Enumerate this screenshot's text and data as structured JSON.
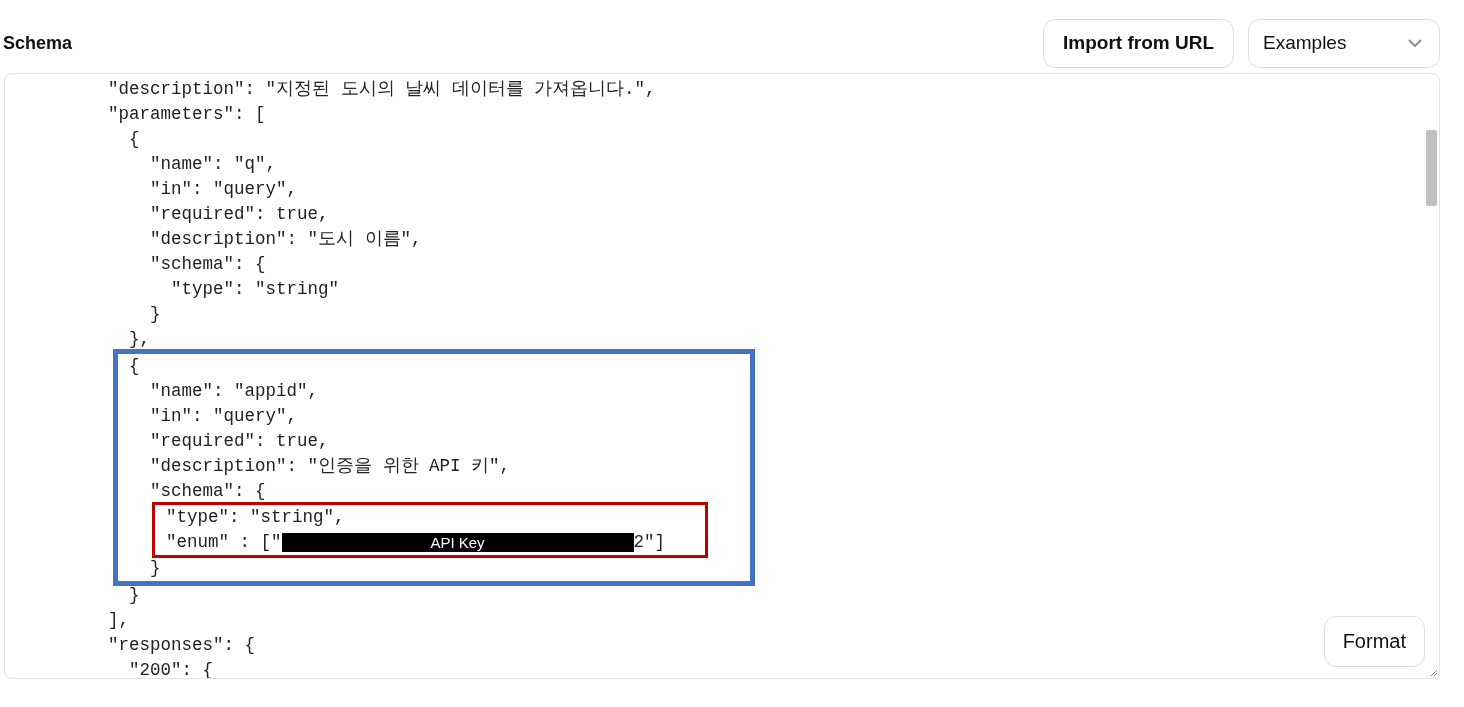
{
  "header": {
    "title": "Schema",
    "import_button": "Import from URL",
    "examples_select": "Examples"
  },
  "editor": {
    "blocks": [
      {
        "kind": "line",
        "text": "\"description\": \"지정된 도시의 날씨 데이터를 가져옵니다.\","
      },
      {
        "kind": "line",
        "text": "\"parameters\": ["
      },
      {
        "kind": "line",
        "text": "  {"
      },
      {
        "kind": "line",
        "text": "    \"name\": \"q\","
      },
      {
        "kind": "line",
        "text": "    \"in\": \"query\","
      },
      {
        "kind": "line",
        "text": "    \"required\": true,"
      },
      {
        "kind": "line",
        "text": "    \"description\": \"도시 이름\","
      },
      {
        "kind": "line",
        "text": "    \"schema\": {"
      },
      {
        "kind": "line",
        "text": "      \"type\": \"string\""
      },
      {
        "kind": "line",
        "text": "    }"
      },
      {
        "kind": "line",
        "text": "  },"
      },
      {
        "kind": "highlight",
        "children": [
          {
            "kind": "line",
            "text": "  {"
          },
          {
            "kind": "line",
            "text": "    \"name\": \"appid\","
          },
          {
            "kind": "line",
            "text": "    \"in\": \"query\","
          },
          {
            "kind": "line",
            "text": "    \"required\": true,"
          },
          {
            "kind": "line",
            "text": "    \"description\": \"인증을 위한 API 키\","
          },
          {
            "kind": "line",
            "text": "    \"schema\": {"
          },
          {
            "kind": "inner_highlight",
            "children": [
              {
                "kind": "line",
                "text": "      \"type\": \"string\","
              },
              {
                "kind": "redacted_line",
                "before": "      \"enum\" : [\"",
                "redaction": "API Key",
                "after": "2\"]"
              }
            ]
          },
          {
            "kind": "line",
            "text": "    }"
          }
        ]
      },
      {
        "kind": "line",
        "text": "  }"
      },
      {
        "kind": "line",
        "text": "],"
      },
      {
        "kind": "line",
        "text": "\"responses\": {"
      },
      {
        "kind": "line",
        "text": "  \"200\": {"
      }
    ],
    "format_button": "Format"
  }
}
